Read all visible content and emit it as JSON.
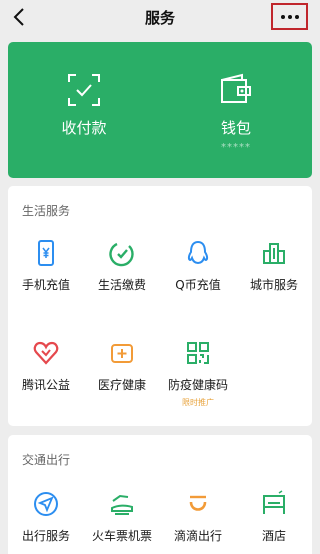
{
  "header": {
    "title": "服务",
    "back_icon": "chevron-left-icon",
    "more_icon": "more-dots-icon"
  },
  "pay_card": {
    "color": "#2aae67",
    "receive": {
      "label": "收付款",
      "icon": "scan-check-icon"
    },
    "wallet": {
      "label": "钱包",
      "mask": "*****",
      "icon": "wallet-icon"
    }
  },
  "life": {
    "title": "生活服务",
    "items": [
      {
        "label": "手机充值",
        "icon": "phone-yen-icon",
        "color": "#2c8ef0"
      },
      {
        "label": "生活缴费",
        "icon": "leaf-check-icon",
        "color": "#2aae67"
      },
      {
        "label": "Q币充值",
        "icon": "qq-penguin-icon",
        "color": "#2c8ef0"
      },
      {
        "label": "城市服务",
        "icon": "city-buildings-icon",
        "color": "#2aae67"
      },
      {
        "label": "腾讯公益",
        "icon": "heart-icon",
        "color": "#e5484d"
      },
      {
        "label": "医疗健康",
        "icon": "medical-box-icon",
        "color": "#f29b38"
      },
      {
        "label": "防疫健康码",
        "icon": "qr-code-icon",
        "color": "#2aae67",
        "sub": "限时推广"
      }
    ]
  },
  "traffic": {
    "title": "交通出行",
    "items": [
      {
        "label": "出行服务",
        "icon": "navigation-icon",
        "color": "#2c8ef0"
      },
      {
        "label": "火车票机票",
        "icon": "train-plane-icon",
        "color": "#2aae67"
      },
      {
        "label": "滴滴出行",
        "icon": "didi-icon",
        "color": "#f29b38"
      },
      {
        "label": "酒店",
        "icon": "hotel-bed-icon",
        "color": "#2aae67"
      }
    ]
  }
}
